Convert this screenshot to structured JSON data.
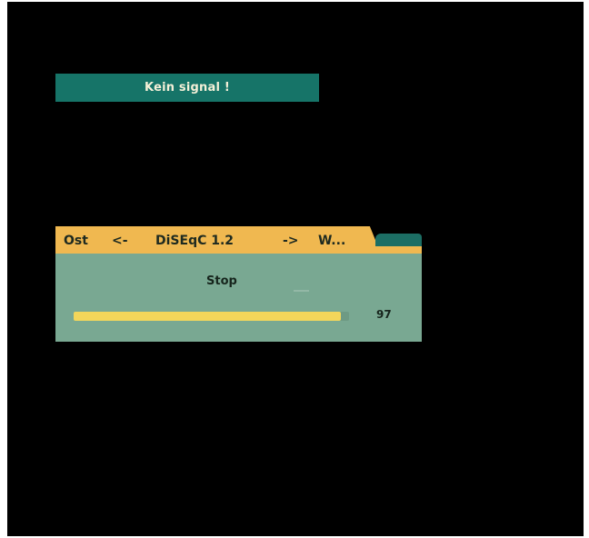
{
  "status": {
    "message": "Kein signal !"
  },
  "motor_panel": {
    "left_direction": "Ost",
    "left_arrow": "<-",
    "mode": "DiSEqC 1.2",
    "right_arrow": "->",
    "right_direction": "W..."
  },
  "action": {
    "label": "Stop",
    "secondary": "..."
  },
  "signal": {
    "value_label": "97",
    "fill_percent": 97
  },
  "colors": {
    "background": "#000000",
    "status_bar": "#167468",
    "tab_bar": "#f0b850",
    "panel_body": "#79a892",
    "progress_fill": "#f3d65a"
  }
}
